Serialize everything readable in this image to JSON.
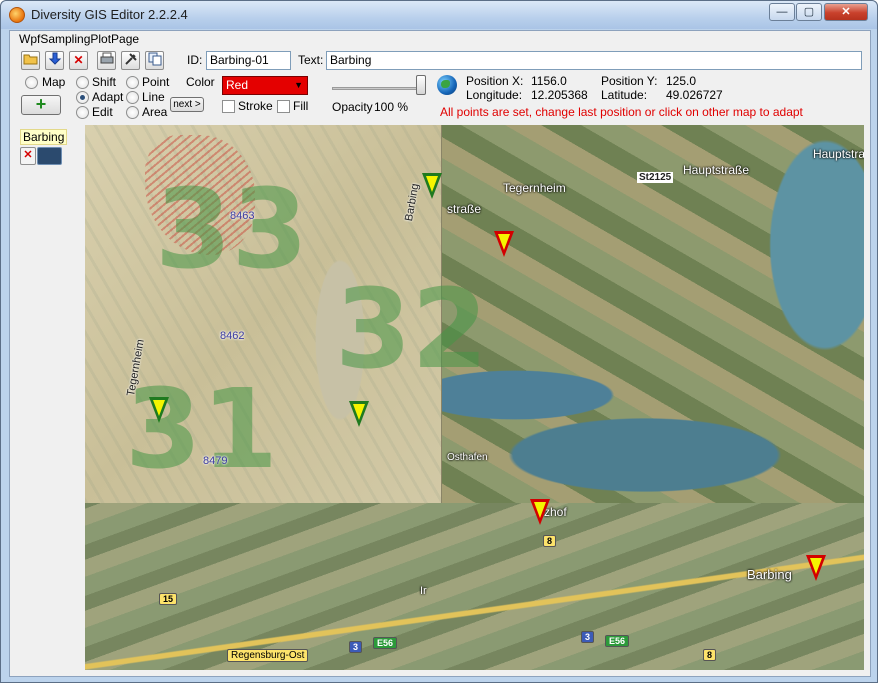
{
  "window": {
    "title": "Diversity GIS Editor 2.2.2.4",
    "controls": {
      "minimize": "—",
      "maximize": "▢",
      "close": "✕"
    }
  },
  "page": {
    "label": "WpfSamplingPlotPage"
  },
  "toolbar": {
    "icons": [
      "open-folder-icon",
      "download-icon",
      "delete-icon",
      "print-icon",
      "tools-icon",
      "copy-icon"
    ]
  },
  "fields": {
    "id_label": "ID:",
    "id_value": "Barbing-01",
    "text_label": "Text:",
    "text_value": "Barbing"
  },
  "modes": {
    "map": "Map",
    "shift": "Shift",
    "adapt": "Adapt",
    "edit": "Edit",
    "point": "Point",
    "line": "Line",
    "area": "Area",
    "selected_mode": "Adapt",
    "selected_shape": "none"
  },
  "style": {
    "color_label": "Color",
    "color_value": "Red",
    "color_hex": "#e40000",
    "stroke_label": "Stroke",
    "fill_label": "Fill",
    "stroke_checked": false,
    "fill_checked": false,
    "opacity_label": "Opacity",
    "opacity_value": "100 %",
    "opacity_fraction": 1.0
  },
  "next_button": "next >",
  "add_button": "+",
  "position": {
    "x_label": "Position X:",
    "x_value": "1156.0",
    "y_label": "Position Y:",
    "y_value": "125.0",
    "lon_label": "Longitude:",
    "lon_value": "12.205368",
    "lat_label": "Latitude:",
    "lat_value": "49.026727"
  },
  "status_message": "All points are set, change last position or click on other map to adapt",
  "sidebar": {
    "item_label": "Barbing"
  },
  "map": {
    "labels": {
      "tegernheim": "Tegernheim",
      "hauptstrasse": "Hauptstraße",
      "hauptstrasse2": "Hauptstraße",
      "st2125": "St2125",
      "strasse": "straße",
      "osthafen": "Osthafen",
      "zhof": "zhof",
      "barbing": "Barbing",
      "regensburg_ost": "Regensburg-Ost",
      "ir": "Ir",
      "old_tegernheim": "Tegernheim",
      "old_barbing": "Barbing"
    },
    "roads": {
      "r8a": "8",
      "r8b": "8",
      "r15": "15",
      "r3a": "3",
      "r3b": "3",
      "e56a": "E56",
      "e56b": "E56"
    },
    "old_numbers": [
      "33",
      "31",
      "32"
    ],
    "old_small": [
      "8463",
      "8462",
      "8479"
    ]
  },
  "colors": {
    "status": "#e00000",
    "accent_green": "#1f7a1f",
    "marker_red": "#d20000",
    "marker_yellow": "#f5f500"
  }
}
